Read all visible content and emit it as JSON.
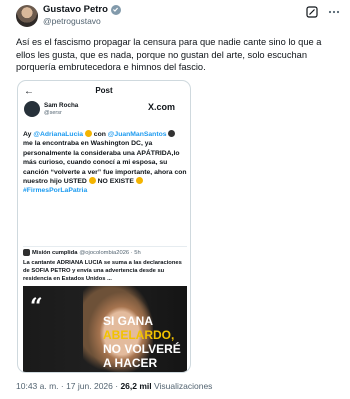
{
  "author": {
    "name": "Gustavo Petro",
    "handle": "@petrogustavo"
  },
  "body": "Así es el fascismo propagar la censura para que nadie cante sino lo que a ellos les gusta, que es nada, porque no gustan del arte, solo escuchan porquería embrutecedora e himnos del fascio.",
  "card": {
    "header_title": "Post",
    "inner_author": {
      "name": "Sam Rocha",
      "handle": "@sersr",
      "site": "X.com"
    },
    "tweet_parts": {
      "p1": "Ay ",
      "m1": "@AdrianaLucia",
      "p2": " con ",
      "m2": "@JuanManSantos",
      "p3": " me la encontraba en Washington DC, ya personalmente la consideraba una APÁTRIDA,lo más curioso, cuando conocí a mi esposa, su canción “volverte a ver” fue importante, ahora con nuestro hijo USTED ",
      "p4": " NO EXISTE ",
      "m3": "#FirmesPorLaPatria"
    },
    "quote": {
      "title": "Misión cumplida",
      "handle": "@ojocolombia2026 · 5h",
      "text": "La cantante ADRIANA LUCIA se suma a las declaraciones de SOFIA PETRO y envía una advertencia desde su residencia en Estados Unidos ...",
      "image_lines": [
        "SI GANA",
        "ABELARDO,",
        "NO VOLVERÉ",
        "A HACER"
      ]
    }
  },
  "meta": {
    "time": "10:43 a. m. · 17 jun. 2026 · ",
    "views": "26,2 mil",
    "views_label": " Visualizaciones"
  },
  "icons": [
    "grok-icon",
    "more-icon",
    "verified-icon",
    "back-arrow-icon"
  ]
}
